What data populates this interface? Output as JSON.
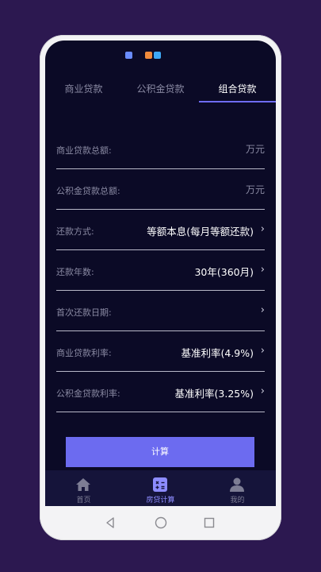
{
  "tabs": [
    {
      "label": "商业贷款",
      "active": false
    },
    {
      "label": "公积金贷款",
      "active": false
    },
    {
      "label": "组合贷款",
      "active": true
    }
  ],
  "form": {
    "rows": [
      {
        "label": "商业贷款总额:",
        "unit": "万元"
      },
      {
        "label": "公积金贷款总额:",
        "unit": "万元"
      },
      {
        "label": "还款方式:",
        "value": "等额本息(每月等额还款)",
        "chevron": "›"
      },
      {
        "label": "还款年数:",
        "value": "30年(360月)",
        "chevron": "›"
      },
      {
        "label": "首次还款日期:",
        "value": "",
        "chevron": "›"
      },
      {
        "label": "商业贷款利率:",
        "value": "基准利率(4.9%)",
        "chevron": "›"
      },
      {
        "label": "公积金贷款利率:",
        "value": "基准利率(3.25%)",
        "chevron": "›"
      }
    ]
  },
  "calculate_label": "计算",
  "bottom_nav": [
    {
      "label": "首页",
      "icon": "home-icon",
      "active": false
    },
    {
      "label": "房贷计算",
      "icon": "calculator-icon",
      "active": true
    },
    {
      "label": "我的",
      "icon": "user-icon",
      "active": false
    }
  ],
  "colors": {
    "accent": "#6c6bf0",
    "screen_bg": "#0b0a26",
    "page_bg": "#2c1850",
    "nav_bg": "#15143a"
  }
}
